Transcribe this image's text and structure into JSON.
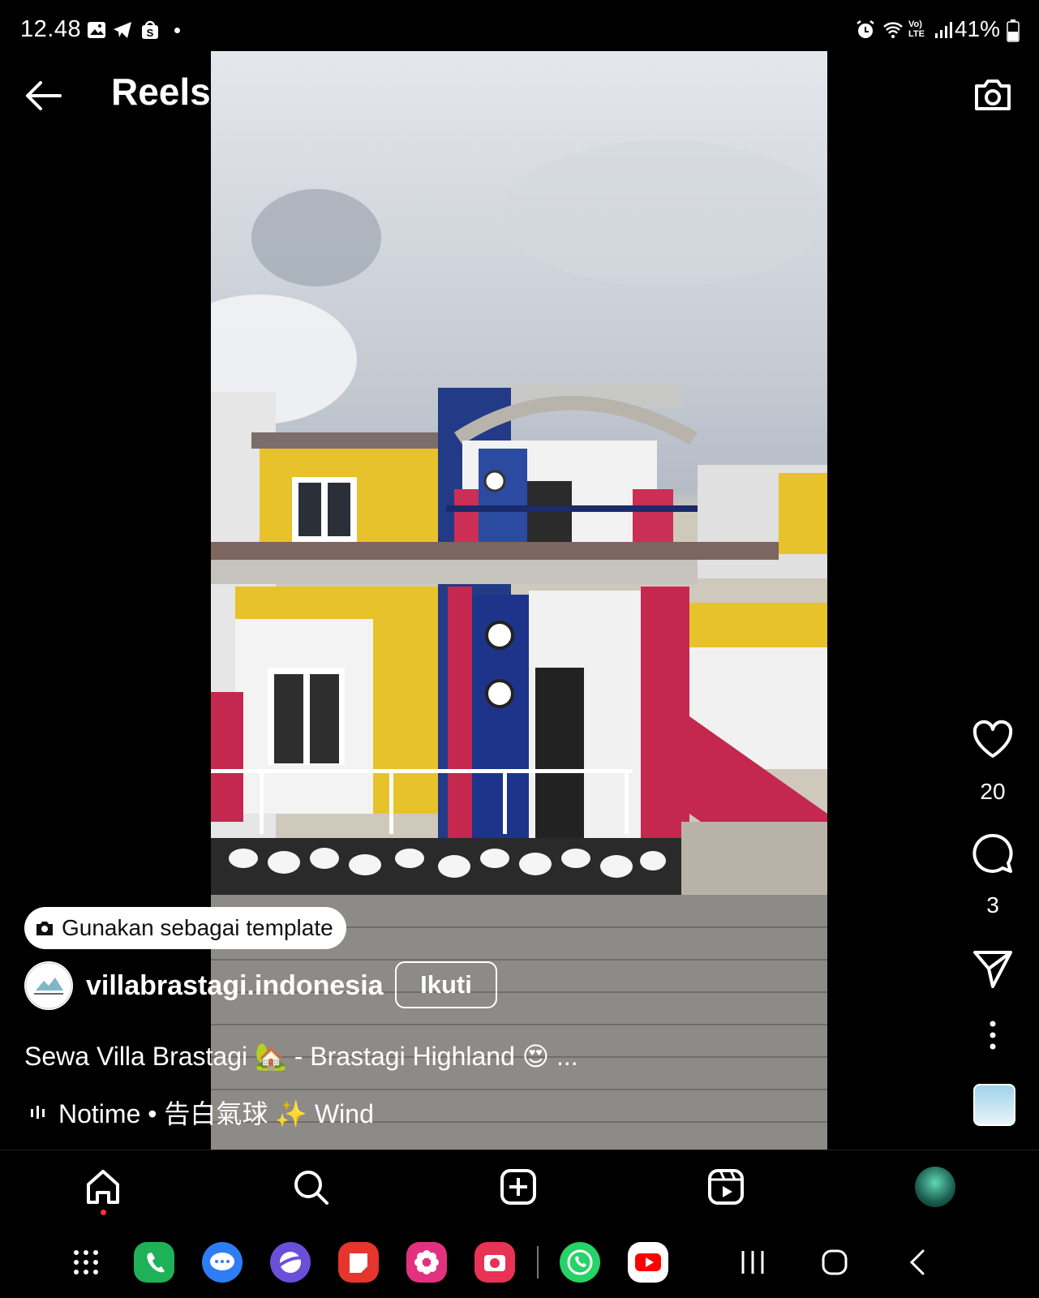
{
  "status_bar": {
    "time": "12.48",
    "battery": "41%",
    "left_icons": [
      "gallery-icon",
      "telegram-icon",
      "shopee-icon",
      "dot-icon"
    ],
    "right_icons": [
      "alarm-icon",
      "wifi-icon",
      "volte-icon",
      "signal-icon",
      "battery-icon"
    ]
  },
  "header": {
    "title": "Reels"
  },
  "reel": {
    "likes": "20",
    "comments": "3",
    "template_label": "Gunakan sebagai template",
    "username": "villabrastagi.indonesia",
    "follow_label": "Ikuti",
    "caption": "Sewa Villa Brastagi 🏡 - Brastagi Highland 😍 ...",
    "music": "Notime • 告白氣球 ✨ Wind"
  },
  "bottom_nav": [
    "home-icon",
    "search-icon",
    "create-icon",
    "reels-icon",
    "profile-avatar"
  ],
  "dock_apps": [
    {
      "name": "phone",
      "color": "#1fb157"
    },
    {
      "name": "messages",
      "color": "#2e7df6"
    },
    {
      "name": "internet",
      "color": "#6b4fd8"
    },
    {
      "name": "notes",
      "color": "#e5352c"
    },
    {
      "name": "gallery",
      "color": "#e2317e"
    },
    {
      "name": "camera",
      "color": "#e83256"
    },
    {
      "name": "whatsapp",
      "color": "#25d366"
    },
    {
      "name": "youtube",
      "color": "#ffffff"
    }
  ]
}
